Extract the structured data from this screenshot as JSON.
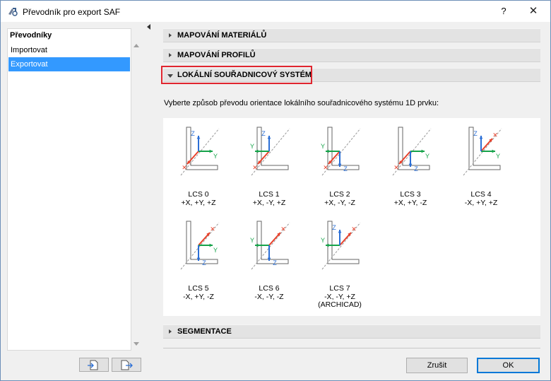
{
  "window": {
    "title": "Převodník pro export SAF",
    "help_label": "?",
    "close_label": "✕"
  },
  "sidebar": {
    "header": "Převodníky",
    "items": [
      {
        "label": "Importovat",
        "selected": false
      },
      {
        "label": "Exportovat",
        "selected": true
      }
    ]
  },
  "sections": {
    "materials": "MAPOVÁNÍ MATERIÁLŮ",
    "profiles": "MAPOVÁNÍ PROFILŮ",
    "lcs": "LOKÁLNÍ SOUŘADNICOVÝ SYSTÉM",
    "segmentation": "SEGMENTACE"
  },
  "lcs_description": "Vyberte způsob převodu orientace lokálního souřadnicového systému 1D prvku:",
  "lcs_options": [
    {
      "name": "LCS 0",
      "axes": "+X, +Y, +Z",
      "note": "",
      "selected": true
    },
    {
      "name": "LCS 1",
      "axes": "+X, -Y, +Z",
      "note": "",
      "selected": false
    },
    {
      "name": "LCS 2",
      "axes": "+X, -Y, -Z",
      "note": "",
      "selected": false
    },
    {
      "name": "LCS 3",
      "axes": "+X, +Y, -Z",
      "note": "",
      "selected": false
    },
    {
      "name": "LCS 4",
      "axes": "-X, +Y, +Z",
      "note": "",
      "selected": false
    },
    {
      "name": "LCS 5",
      "axes": "-X, +Y, -Z",
      "note": "",
      "selected": false
    },
    {
      "name": "LCS 6",
      "axes": "-X, -Y, -Z",
      "note": "",
      "selected": false
    },
    {
      "name": "LCS 7",
      "axes": "-X, -Y, +Z",
      "note": "(ARCHICAD)",
      "selected": false
    }
  ],
  "axis_letters": {
    "x": "X",
    "y": "Y",
    "z": "Z"
  },
  "colors": {
    "x_axis": "#e8412b",
    "y_axis": "#16a34a",
    "z_axis": "#2b6fd6",
    "accent": "#3399ff",
    "highlight": "#e0262f"
  },
  "buttons": {
    "cancel": "Zrušit",
    "ok": "OK"
  }
}
